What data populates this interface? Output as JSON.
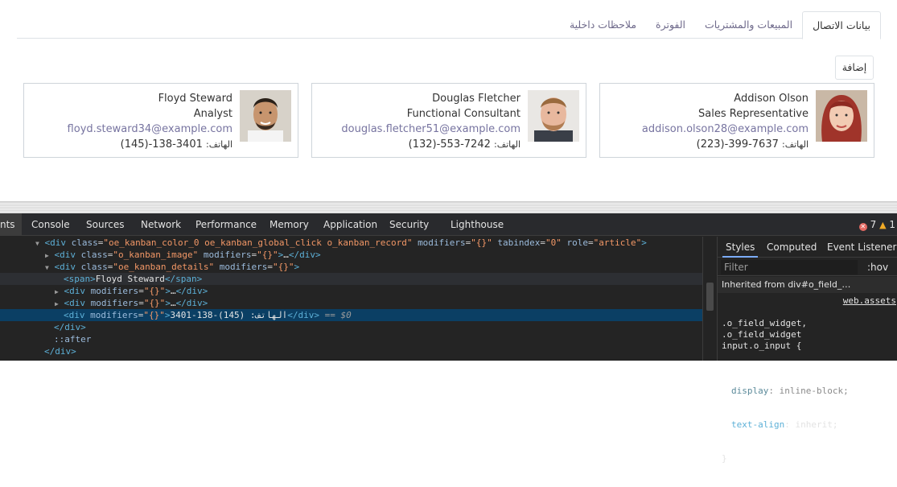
{
  "tabs": [
    {
      "label": "بيانات الاتصال",
      "active": true
    },
    {
      "label": "المبيعات والمشتريات",
      "active": false
    },
    {
      "label": "الفوترة",
      "active": false
    },
    {
      "label": "ملاحظات داخلية",
      "active": false
    }
  ],
  "add_button": "إضافة",
  "phone_label": "الهاتف:",
  "contacts": [
    {
      "name": "Addison Olson",
      "function": "Sales Representative",
      "email": "addison.olson28@example.com",
      "phone": "(223)-399-7637"
    },
    {
      "name": "Douglas Fletcher",
      "function": "Functional Consultant",
      "email": "douglas.fletcher51@example.com",
      "phone": "(132)-553-7242"
    },
    {
      "name": "Floyd Steward",
      "function": "Analyst",
      "email": "floyd.steward34@example.com",
      "phone": "(145)-138-3401"
    }
  ],
  "devtools": {
    "tabs": [
      "nts",
      "Console",
      "Sources",
      "Network",
      "Performance",
      "Memory",
      "Application",
      "Security",
      "Lighthouse"
    ],
    "errors": "7",
    "warnings": "1",
    "dom_lines": [
      {
        "tag_open": "<div",
        "attrs": [
          [
            "class",
            "\"oe_kanban_color_0 oe_kanban_global_click o_kanban_record\""
          ],
          [
            "modifiers",
            "\"{}\""
          ],
          [
            "tabindex",
            "\"0\""
          ],
          [
            "role",
            "\"article\""
          ]
        ],
        "tail": ">"
      },
      {
        "tag_open": "<div",
        "attrs": [
          [
            "class",
            "\"o_kanban_image\""
          ],
          [
            "modifiers",
            "\"{}\""
          ]
        ],
        "tail": ">…</div>"
      },
      {
        "tag_open": "<div",
        "attrs": [
          [
            "class",
            "\"oe_kanban_details\""
          ],
          [
            "modifiers",
            "\"{}\""
          ]
        ],
        "tail": ">"
      },
      {
        "text": "<span>Floyd Steward</span>"
      },
      {
        "tag_open": "<div",
        "attrs": [
          [
            "modifiers",
            "\"{}\""
          ]
        ],
        "tail": ">…</div>"
      },
      {
        "tag_open": "<div",
        "attrs": [
          [
            "modifiers",
            "\"{}\""
          ]
        ],
        "tail": ">…</div>"
      },
      {
        "selected_text": "<div modifiers=\"{}\">3401-138-(145) :الهاتف</div>",
        "selected_suffix": "== $0"
      },
      {
        "text": "</div>"
      },
      {
        "text": "::after"
      },
      {
        "text": "</div>"
      }
    ],
    "styles_tabs": [
      "Styles",
      "Computed",
      "Event Listeners"
    ],
    "filter_placeholder": "Filter",
    "hov": ":hov",
    "inherited": "Inherited from div#o_field_…",
    "rule_selector": ".o_field_widget,\n.o_field_widget\ninput.o_input {",
    "rule_source": "web.assets",
    "rule_decl1_prop": "display",
    "rule_decl1_val": "inline-block;",
    "rule_decl2_prop": "text-align",
    "rule_decl2_val": "inherit;",
    "rule_close": "}"
  }
}
